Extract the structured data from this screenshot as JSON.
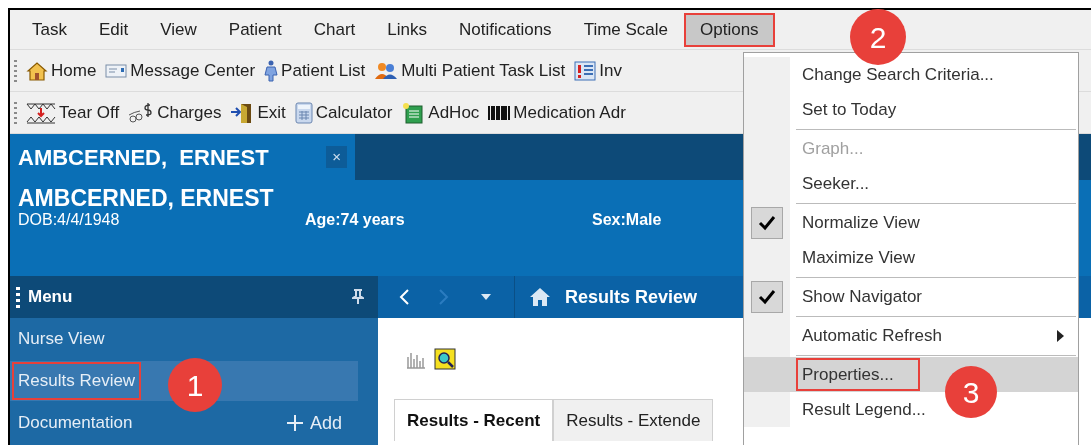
{
  "menu_bar": [
    {
      "label": "Task",
      "selected": false,
      "outlined": false
    },
    {
      "label": "Edit",
      "selected": false,
      "outlined": false
    },
    {
      "label": "View",
      "selected": false,
      "outlined": false
    },
    {
      "label": "Patient",
      "selected": false,
      "outlined": false
    },
    {
      "label": "Chart",
      "selected": false,
      "outlined": false
    },
    {
      "label": "Links",
      "selected": false,
      "outlined": false
    },
    {
      "label": "Notifications",
      "selected": false,
      "outlined": false
    },
    {
      "label": "Time Scale",
      "selected": false,
      "outlined": false
    },
    {
      "label": "Options",
      "selected": true,
      "outlined": true
    }
  ],
  "toolbar_1": [
    {
      "label": "Home"
    },
    {
      "label": "Message Center"
    },
    {
      "label": "Patient List"
    },
    {
      "label": "Multi Patient Task List"
    },
    {
      "label": "Inv"
    }
  ],
  "toolbar_2": [
    {
      "label": "Tear Off"
    },
    {
      "label": "Charges"
    },
    {
      "label": "Exit"
    },
    {
      "label": "Calculator"
    },
    {
      "label": "AdHoc"
    },
    {
      "label": "Medication Adr"
    }
  ],
  "patient_tab": {
    "label": "AMBCERNED,  ERNEST",
    "close": "×"
  },
  "banner": {
    "name": "AMBCERNED, ERNEST",
    "dob": "DOB:4/4/1948",
    "age": "Age:74 years",
    "sex": "Sex:Male"
  },
  "sidebar": {
    "title": "Menu",
    "items": [
      {
        "label": "Nurse View",
        "selected": false,
        "outlined": false
      },
      {
        "label": "Results Review",
        "selected": true,
        "outlined": true
      },
      {
        "label": "Documentation",
        "selected": false,
        "outlined": false
      }
    ],
    "add_label": "Add"
  },
  "navigator": {
    "title": "Results Review"
  },
  "content_tabs": [
    {
      "label": "Results - Recent",
      "selected": true
    },
    {
      "label": "Results - Extende",
      "selected": false
    }
  ],
  "options_menu": [
    {
      "kind": "item",
      "label": "Change Search Criteria...",
      "checked": false,
      "disabled": false,
      "selected": false,
      "outlined": false,
      "submenu": false
    },
    {
      "kind": "item",
      "label": "Set to Today",
      "checked": false,
      "disabled": false,
      "selected": false,
      "outlined": false,
      "submenu": false
    },
    {
      "kind": "separator"
    },
    {
      "kind": "item",
      "label": "Graph...",
      "checked": false,
      "disabled": true,
      "selected": false,
      "outlined": false,
      "submenu": false
    },
    {
      "kind": "item",
      "label": "Seeker...",
      "checked": false,
      "disabled": false,
      "selected": false,
      "outlined": false,
      "submenu": false
    },
    {
      "kind": "separator"
    },
    {
      "kind": "item",
      "label": "Normalize View",
      "checked": true,
      "disabled": false,
      "selected": false,
      "outlined": false,
      "submenu": false
    },
    {
      "kind": "item",
      "label": "Maximize View",
      "checked": false,
      "disabled": false,
      "selected": false,
      "outlined": false,
      "submenu": false
    },
    {
      "kind": "separator"
    },
    {
      "kind": "item",
      "label": "Show Navigator",
      "checked": true,
      "disabled": false,
      "selected": false,
      "outlined": false,
      "submenu": false
    },
    {
      "kind": "separator"
    },
    {
      "kind": "item",
      "label": "Automatic Refresh",
      "checked": false,
      "disabled": false,
      "selected": false,
      "outlined": false,
      "submenu": true
    },
    {
      "kind": "separator"
    },
    {
      "kind": "item",
      "label": "Properties...",
      "checked": false,
      "disabled": false,
      "selected": true,
      "outlined": true,
      "submenu": false
    },
    {
      "kind": "item",
      "label": "Result Legend...",
      "checked": false,
      "disabled": false,
      "selected": false,
      "outlined": false,
      "submenu": false
    }
  ],
  "annotations": [
    {
      "label": "1"
    },
    {
      "label": "2"
    },
    {
      "label": "3"
    }
  ]
}
